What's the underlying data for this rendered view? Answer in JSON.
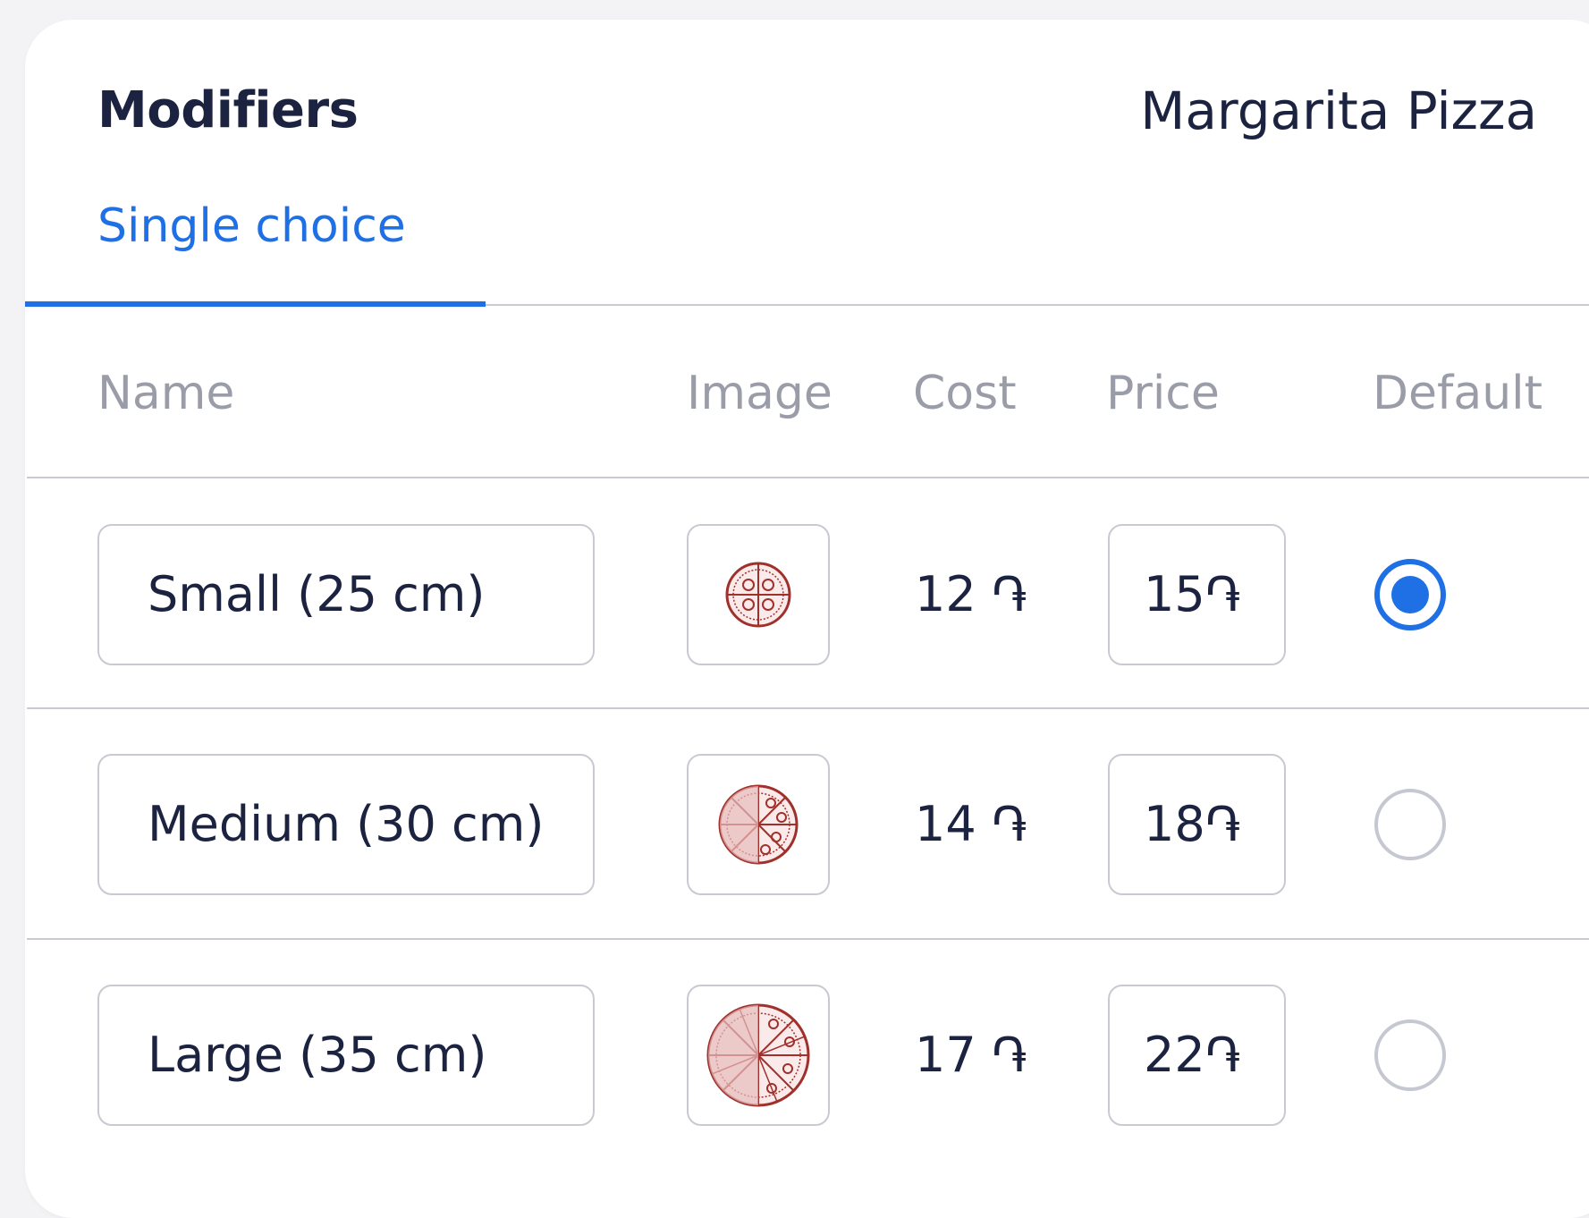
{
  "header": {
    "title": "Modifiers",
    "product_name": "Margarita Pizza"
  },
  "tabs": [
    {
      "label": "Single choice",
      "active": true
    }
  ],
  "table": {
    "columns": [
      "Name",
      "Image",
      "Cost",
      "Price",
      "Default"
    ],
    "rows": [
      {
        "name": "Small (25 cm)",
        "image": "pizza-small-icon",
        "cost": "12 ֏",
        "price": "15֏",
        "default": true
      },
      {
        "name": "Medium (30 cm)",
        "image": "pizza-medium-icon",
        "cost": "14 ֏",
        "price": "18֏",
        "default": false
      },
      {
        "name": "Large (35 cm)",
        "image": "pizza-large-icon",
        "cost": "17 ֏",
        "price": "22֏",
        "default": false
      }
    ]
  },
  "colors": {
    "accent": "#1f6fe5",
    "text": "#1c2340",
    "muted": "#9a9da8",
    "border": "#c8cad2",
    "pizza": "#a0302c"
  }
}
